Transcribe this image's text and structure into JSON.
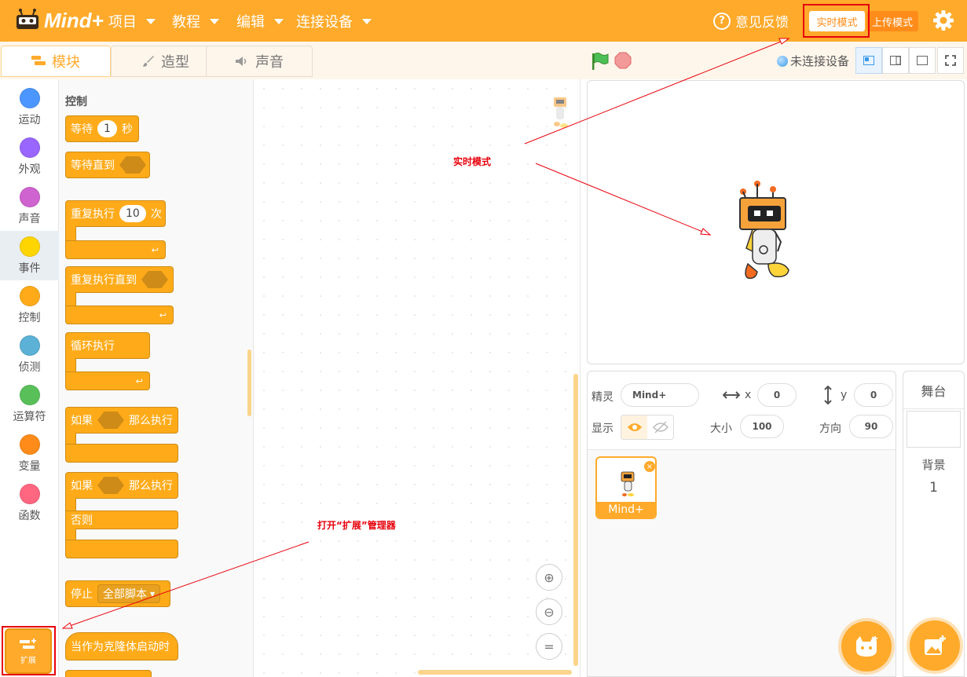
{
  "header": {
    "logo_text": "Mind+",
    "menus": [
      "项目",
      "教程",
      "编辑",
      "连接设备"
    ],
    "feedback_label": "意见反馈",
    "mode_realtime": "实时模式",
    "mode_upload": "上传模式"
  },
  "tabs": [
    "模块",
    "造型",
    "声音"
  ],
  "connection_status": "未连接设备",
  "categories": [
    {
      "label": "运动",
      "color": "#4C97FF"
    },
    {
      "label": "外观",
      "color": "#9966FF"
    },
    {
      "label": "声音",
      "color": "#CF63CF"
    },
    {
      "label": "事件",
      "color": "#FFD500"
    },
    {
      "label": "控制",
      "color": "#FFAB19"
    },
    {
      "label": "侦测",
      "color": "#5CB1D6"
    },
    {
      "label": "运算符",
      "color": "#59C059"
    },
    {
      "label": "变量",
      "color": "#FF8C1A"
    },
    {
      "label": "函数",
      "color": "#FF6680"
    }
  ],
  "extension_label": "扩展",
  "palette": {
    "title": "控制",
    "wait": {
      "label": "等待",
      "value": "1",
      "unit": "秒"
    },
    "wait_until": "等待直到",
    "repeat": {
      "label": "重复执行",
      "value": "10",
      "unit": "次"
    },
    "repeat_until": "重复执行直到",
    "forever": "循环执行",
    "if_then": {
      "if": "如果",
      "then": "那么执行"
    },
    "if_else": {
      "if": "如果",
      "then": "那么执行",
      "else": "否则"
    },
    "stop": {
      "label": "停止",
      "option": "全部脚本"
    },
    "clone_start": "当作为克隆体启动时"
  },
  "sprite_info": {
    "sprite_label": "精灵",
    "sprite_name": "Mind+",
    "x_label": "x",
    "x_value": "0",
    "y_label": "y",
    "y_value": "0",
    "show_label": "显示",
    "size_label": "大小",
    "size_value": "100",
    "direction_label": "方向",
    "direction_value": "90"
  },
  "sprite_card_name": "Mind+",
  "stage_panel": {
    "title": "舞台",
    "backdrop_label": "背景",
    "backdrop_count": "1"
  },
  "annotations": {
    "realtime": "实时模式",
    "extension": "打开“扩展”管理器"
  }
}
